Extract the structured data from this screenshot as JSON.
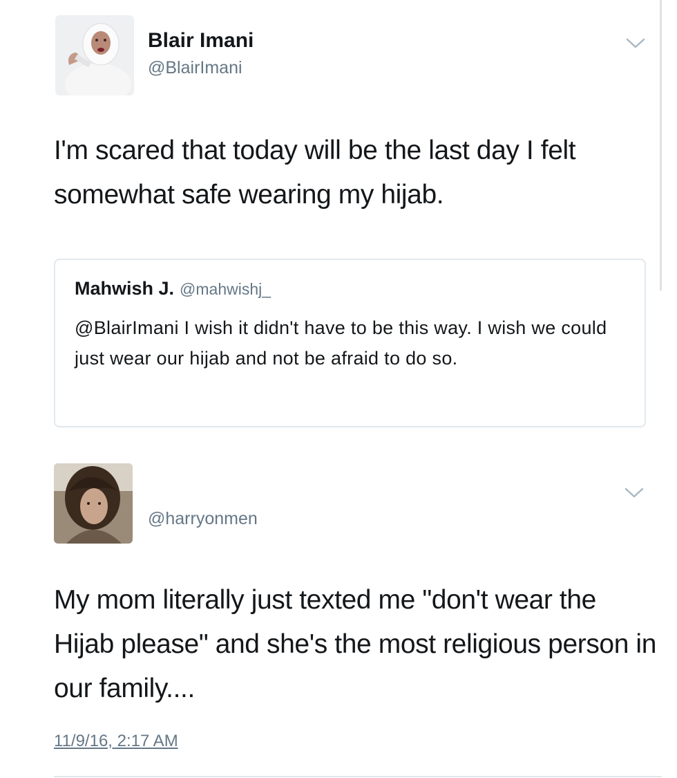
{
  "tweets": [
    {
      "author_name": "Blair Imani",
      "handle": "@BlairImani",
      "text": "I'm scared that today will be the last day I felt somewhat safe wearing my hijab.",
      "quoted": {
        "author_name": "Mahwish J.",
        "handle": "@mahwishj_",
        "text": "@BlairImani I wish it didn't have to be this way. I wish we could just wear our hijab and not be afraid to do so."
      },
      "menu_icon": "chevron-down-icon"
    },
    {
      "handle": "@harryonmen",
      "text": "My mom literally just texted me \"don't wear the Hijab please\" and she's the most religious person in our family....",
      "timestamp": "11/9/16, 2:17 AM",
      "menu_icon": "chevron-down-icon"
    }
  ],
  "colors": {
    "primary_text": "#14171a",
    "secondary_text": "#657786",
    "border": "#e1e8ed"
  }
}
